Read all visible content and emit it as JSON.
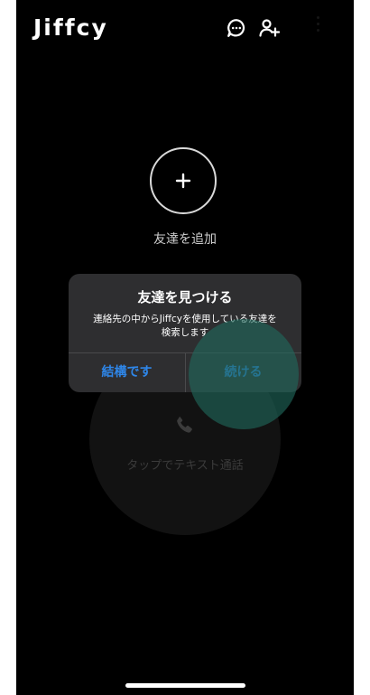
{
  "app": {
    "title": "Jiffcy"
  },
  "header": {
    "icons": [
      "chat-bubble-icon",
      "add-user-icon",
      "overflow-menu-icon"
    ]
  },
  "main": {
    "add_friend_label": "友達を追加",
    "call_label": "タップでテキスト通話"
  },
  "dialog": {
    "title": "友達を見つける",
    "message_line1": "連絡先の中からJiffcyを使用している友達を",
    "message_line2": "検索します",
    "cancel_label": "結構です",
    "continue_label": "続ける"
  },
  "colors": {
    "background": "#000000",
    "dialog_background": "#303032",
    "button_text": "#2e86e8",
    "tap_highlight": "#21695c"
  }
}
